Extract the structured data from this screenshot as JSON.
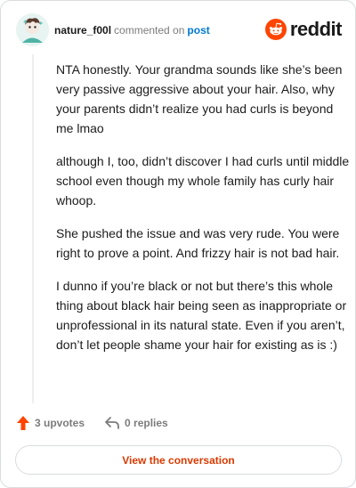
{
  "header": {
    "username": "nature_f00l",
    "commented_text": "commented on",
    "post_link": "post",
    "brand": "reddit"
  },
  "comment": {
    "paragraphs": [
      "NTA honestly. Your grandma sounds like she’s been very passive aggressive about your hair. Also, why your parents didn’t realize you had curls is beyond me lmao",
      "although I, too, didn’t discover I had curls until middle school even though my whole family has curly hair whoop.",
      "She pushed the issue and was very rude. You were right to prove a point. And frizzy hair is not bad hair.",
      "I dunno if you’re black or not but there’s this whole thing about black hair being seen as inappropriate or unprofessional in its natural state. Even if you aren’t, don’t let people shame your hair for existing as is :)"
    ]
  },
  "actions": {
    "upvotes": "3 upvotes",
    "replies": "0 replies"
  },
  "cta": {
    "label": "View the conversation"
  },
  "colors": {
    "accent": "#d93a00",
    "upvote": "#ff4500",
    "link": "#0079d3",
    "muted": "#7c7c7c"
  },
  "icons": {
    "avatar": "user-avatar",
    "brand": "reddit-logo-icon",
    "upvote": "upvote-arrow-icon",
    "reply": "reply-arrow-icon"
  }
}
